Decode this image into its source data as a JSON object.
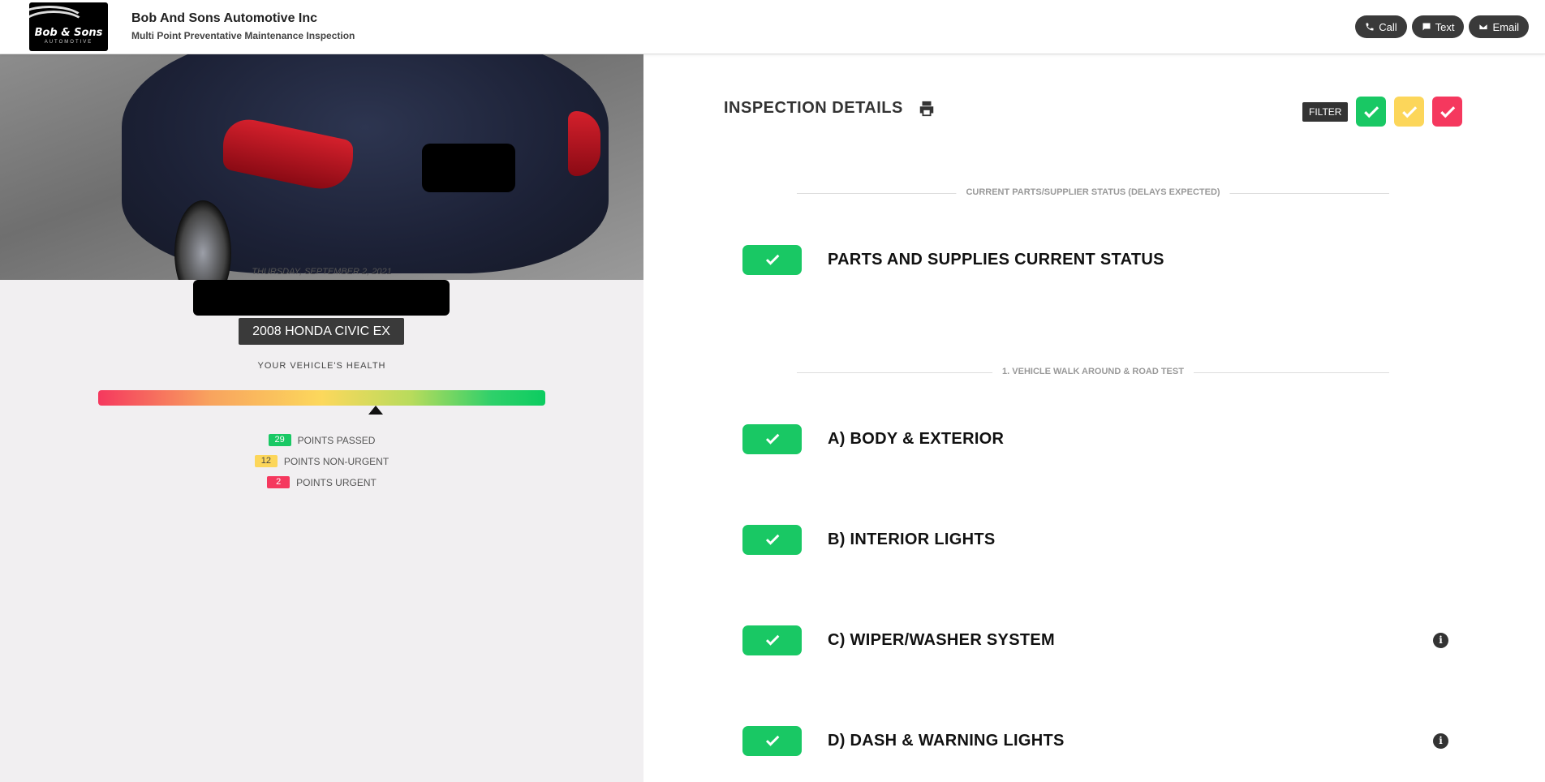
{
  "header": {
    "logo_text": "Bob & Sons",
    "logo_sub": "AUTOMOTIVE",
    "company": "Bob And Sons Automotive Inc",
    "subtitle": "Multi Point Preventative Maintenance Inspection",
    "buttons": [
      {
        "label": "Call",
        "icon": "phone-icon"
      },
      {
        "label": "Text",
        "icon": "chat-icon"
      },
      {
        "label": "Email",
        "icon": "envelope-icon"
      }
    ]
  },
  "vehicle": {
    "date": "THURSDAY, SEPTEMBER 2, 2021",
    "name": "2008 HONDA CIVIC EX",
    "health_label": "YOUR VEHICLE'S HEALTH",
    "health_level": 0.62,
    "points": [
      {
        "count": "29",
        "label": "POINTS PASSED",
        "status": "passed"
      },
      {
        "count": "12",
        "label": "POINTS NON-URGENT",
        "status": "non-urgent"
      },
      {
        "count": "2",
        "label": "POINTS URGENT",
        "status": "urgent"
      }
    ]
  },
  "inspection": {
    "title": "INSPECTION DETAILS",
    "filter_label": "FILTER",
    "colors": {
      "green": "#19c864",
      "yellow": "#fcd65a",
      "red": "#f5385e"
    },
    "sections": [
      {
        "heading": "CURRENT PARTS/SUPPLIER STATUS (DELAYS EXPECTED)",
        "items": [
          {
            "label": "PARTS AND SUPPLIES CURRENT STATUS",
            "status": "passed",
            "info": false
          }
        ]
      },
      {
        "heading": "1. VEHICLE WALK AROUND & ROAD TEST",
        "items": [
          {
            "label": "A) BODY & EXTERIOR",
            "status": "passed",
            "info": false
          },
          {
            "label": "B) INTERIOR LIGHTS",
            "status": "passed",
            "info": false
          },
          {
            "label": "C) WIPER/WASHER SYSTEM",
            "status": "passed",
            "info": true
          },
          {
            "label": "D) DASH & WARNING LIGHTS",
            "status": "passed",
            "info": true
          }
        ]
      }
    ]
  }
}
